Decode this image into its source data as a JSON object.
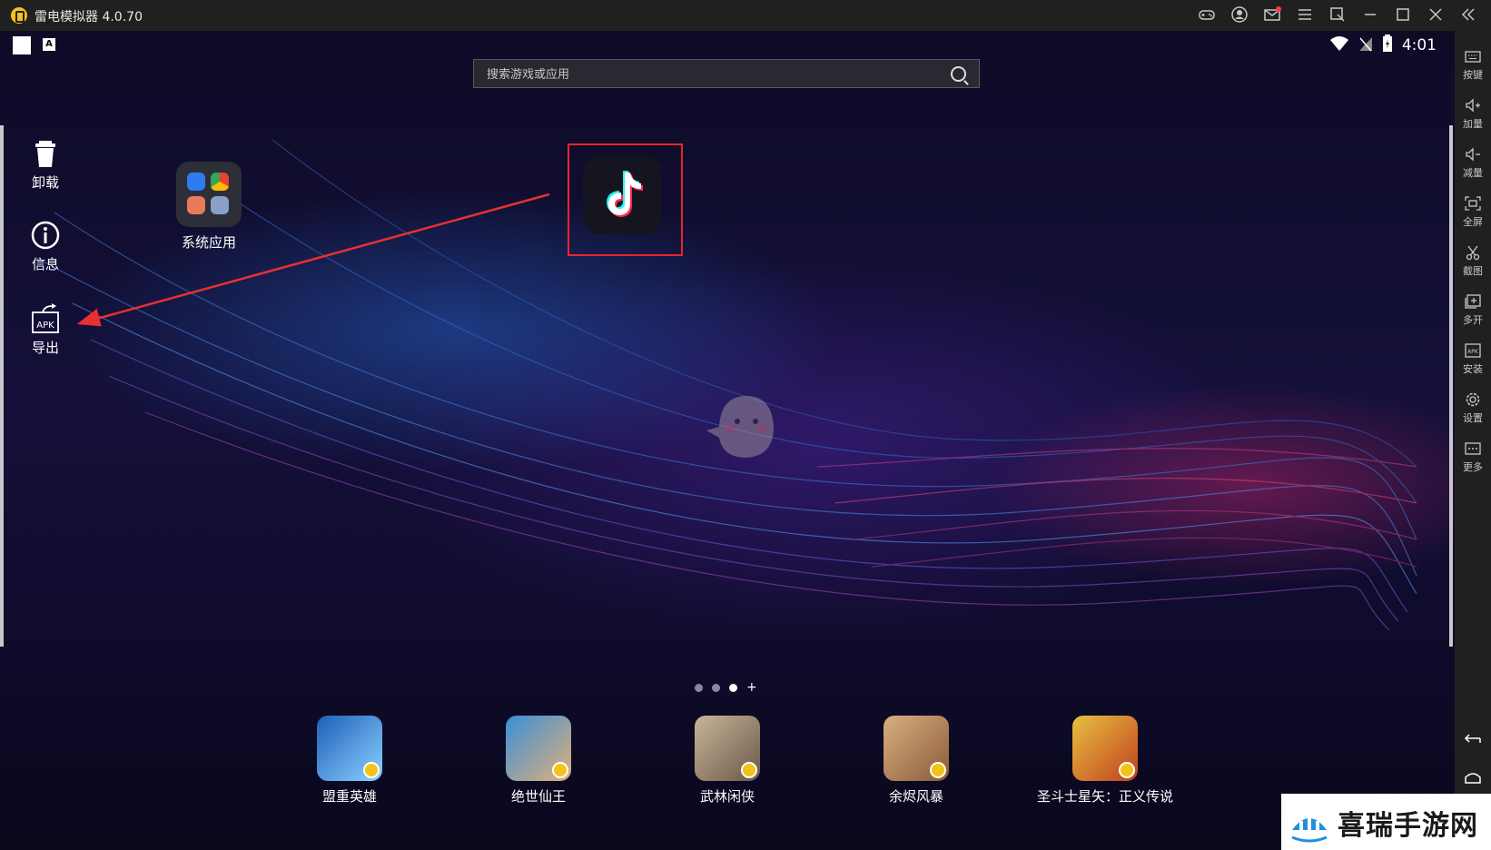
{
  "window": {
    "title": "雷电模拟器 4.0.70",
    "titlebar_icons": [
      "gamepad-icon",
      "user-icon",
      "mail-icon",
      "menu-icon",
      "pin-icon",
      "minimize-icon",
      "maximize-icon",
      "close-icon",
      "collapse-icon"
    ]
  },
  "statusbar": {
    "time": "4:01",
    "keyboard_indicator": "A"
  },
  "search": {
    "placeholder": "搜索游戏或应用"
  },
  "left_tools": [
    {
      "label": "卸载",
      "icon": "trash-icon"
    },
    {
      "label": "信息",
      "icon": "info-icon"
    },
    {
      "label": "导出",
      "icon": "apk-export-icon"
    }
  ],
  "desktop": {
    "folder": {
      "label": "系统应用"
    },
    "highlighted_app": {
      "icon": "tiktok-icon",
      "highlight_color": "#e8262a"
    }
  },
  "pager": {
    "pages": 3,
    "active": 2,
    "add_symbol": "+"
  },
  "dock": [
    {
      "label": "盟重英雄",
      "colors": [
        "#1e5fb8",
        "#8ad0ff"
      ]
    },
    {
      "label": "绝世仙王",
      "colors": [
        "#3a8fd8",
        "#e0b07a"
      ]
    },
    {
      "label": "武林闲侠",
      "colors": [
        "#c9b59a",
        "#6a5848"
      ]
    },
    {
      "label": "余烬风暴",
      "colors": [
        "#d8b080",
        "#8a5a3a"
      ]
    },
    {
      "label": "圣斗士星矢：正义传说",
      "colors": [
        "#e8c040",
        "#c04020"
      ]
    }
  ],
  "right_sidebar": [
    {
      "label": "按键",
      "icon": "keyboard-icon"
    },
    {
      "label": "加量",
      "icon": "volume-up-icon"
    },
    {
      "label": "减量",
      "icon": "volume-down-icon"
    },
    {
      "label": "全屏",
      "icon": "fullscreen-icon"
    },
    {
      "label": "截图",
      "icon": "scissors-icon"
    },
    {
      "label": "多开",
      "icon": "multi-instance-icon"
    },
    {
      "label": "安装",
      "icon": "apk-install-icon"
    },
    {
      "label": "设置",
      "icon": "settings-icon"
    },
    {
      "label": "更多",
      "icon": "more-icon"
    }
  ],
  "watermark": {
    "text": "喜瑞手游网"
  },
  "colors": {
    "accent": "#f3c21b",
    "arrow": "#e8262a",
    "sidebar_bg": "#202020"
  }
}
